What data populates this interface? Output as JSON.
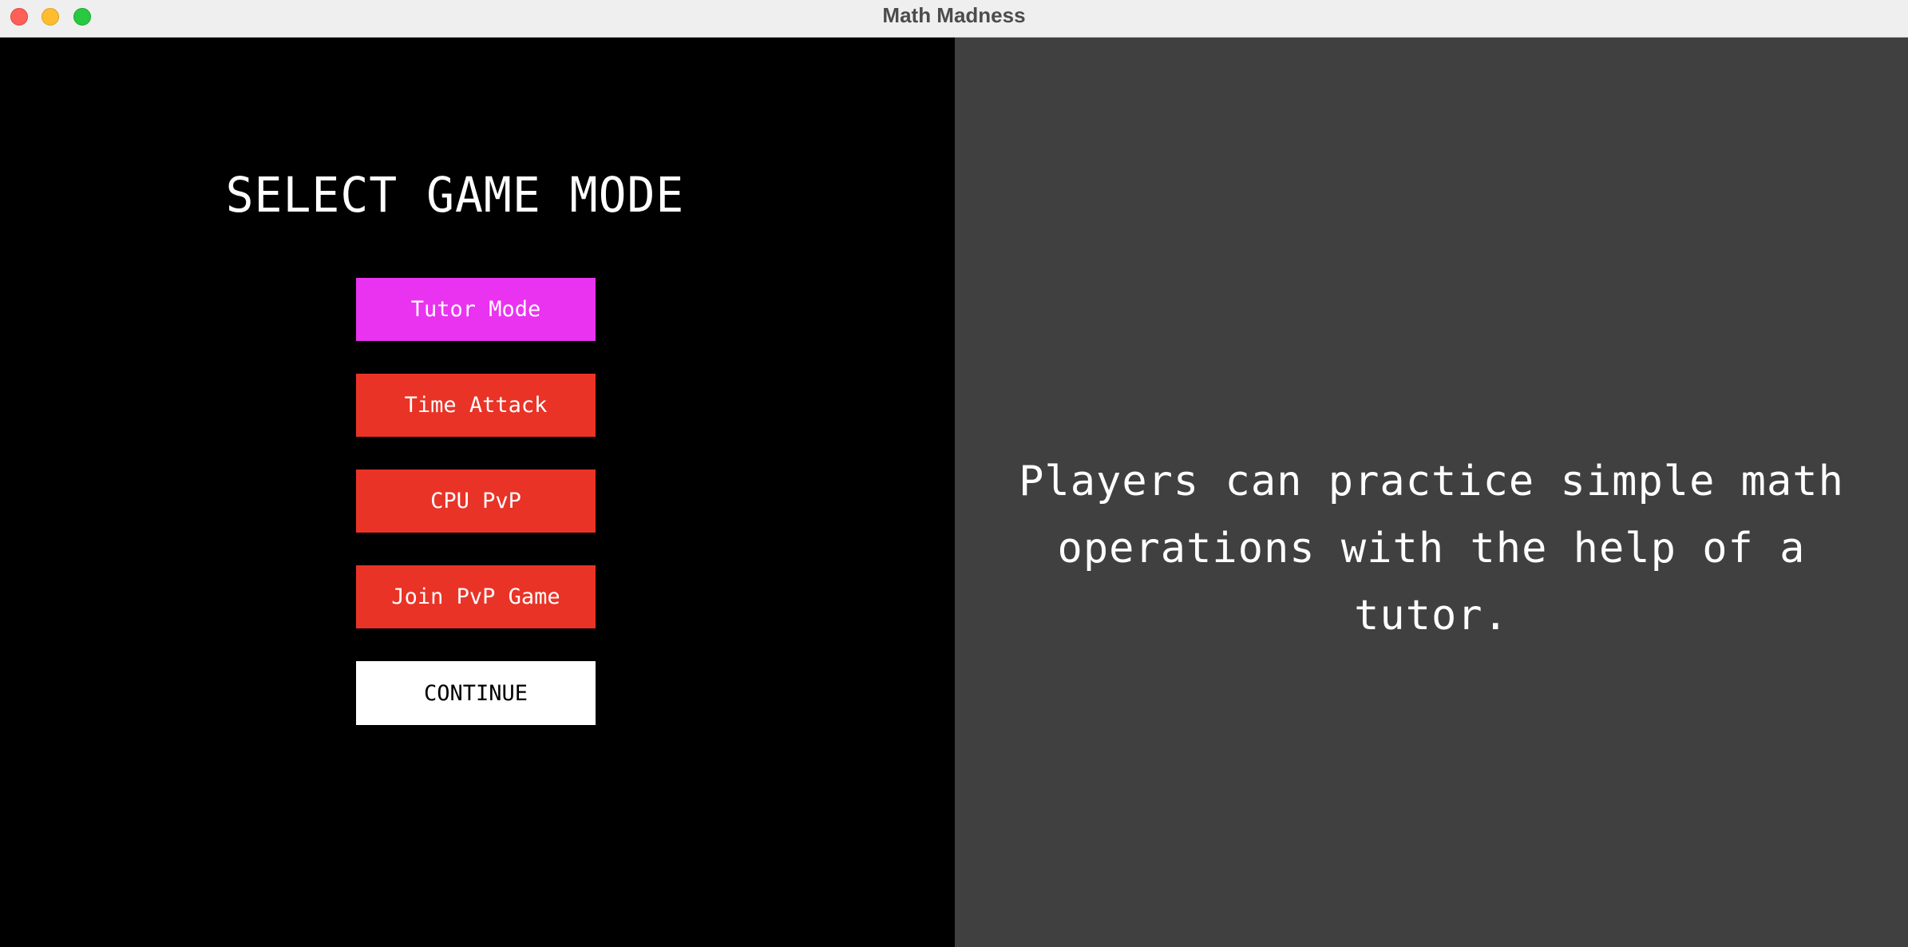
{
  "window": {
    "title": "Math Madness"
  },
  "menu": {
    "heading": "SELECT GAME MODE",
    "modes": [
      {
        "label": "Tutor Mode",
        "selected": true
      },
      {
        "label": "Time Attack",
        "selected": false
      },
      {
        "label": "CPU PvP",
        "selected": false
      },
      {
        "label": "Join PvP Game",
        "selected": false
      }
    ],
    "continue_label": "CONTINUE"
  },
  "description": {
    "text": "Players can practice simple math operations with the help of a tutor."
  },
  "colors": {
    "selected_button": "#e933f0",
    "button": "#e93327",
    "continue_button": "#ffffff",
    "left_background": "#000000",
    "right_background": "#404040"
  }
}
